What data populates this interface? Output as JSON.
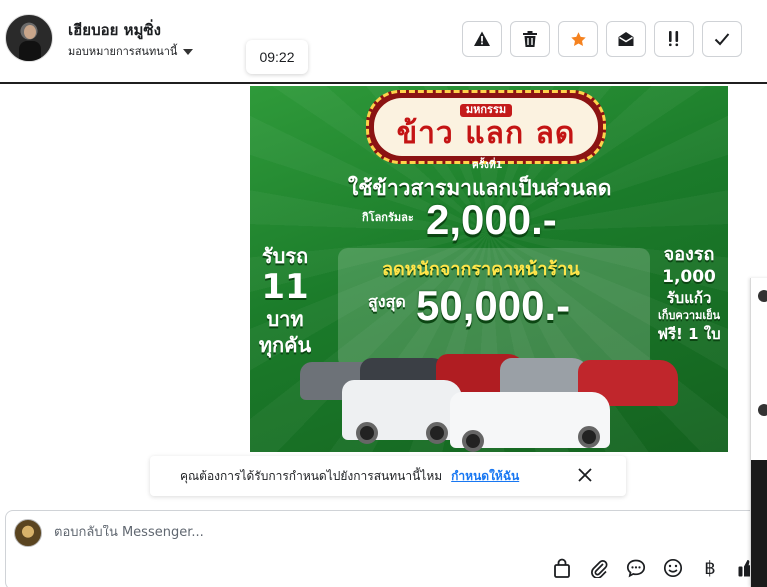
{
  "header": {
    "contact_name": "เฮียบอย หมูซิ่ง",
    "assign_label": "มอบหมายการสนทนานี้",
    "timestamp": "09:22",
    "toolbar": [
      {
        "icon": "warning-icon",
        "name": "report-spam-button"
      },
      {
        "icon": "trash-icon",
        "name": "delete-button"
      },
      {
        "icon": "star-icon",
        "name": "star-button",
        "color": "#f5821f"
      },
      {
        "icon": "envelope-open-icon",
        "name": "mark-unread-button"
      },
      {
        "icon": "follow-up-icon",
        "name": "follow-up-button"
      },
      {
        "icon": "checkmark-icon",
        "name": "mark-done-button"
      }
    ]
  },
  "ad": {
    "sign_small": "มหกรรม",
    "sign_big": "ข้าว แลก ลด",
    "round": "ครั้งที่1",
    "headline": "ใช้ข้าวสารมาแลกเป็นส่วนลด",
    "per_kg": "กิโลกรัมละ",
    "price1": "2,000.-",
    "left_line1": "รับรถ",
    "left_line2": "11",
    "left_line3": "บาท",
    "left_line4": "ทุกคัน",
    "discount_label": "ลดหนักจากราคาหน้าร้าน",
    "max_label": "สูงสุด",
    "price2": "50,000.-",
    "right_line1": "จองรถ",
    "right_line2": "1,000",
    "right_line3": "รับแก้ว",
    "right_line4": "เก็บความเย็น",
    "right_line5": "ฟรี! 1 ใบ"
  },
  "assign_banner": {
    "question": "คุณต้องการได้รับการกำหนดไปยังการสนทนานี้ไหม",
    "link": "กำหนดให้ฉัน"
  },
  "composer": {
    "placeholder": "ตอบกลับใน Messenger...",
    "tools": [
      "bag-icon",
      "paperclip-icon",
      "chat-bubble-icon",
      "smiley-icon",
      "baht-icon",
      "thumbs-up-icon"
    ],
    "baht_symbol": "฿",
    "like_color": "#1c1e21"
  },
  "colors": {
    "accent_blue": "#1877f2",
    "star_orange": "#f5821f",
    "ad_green": "#1b7b2a"
  }
}
